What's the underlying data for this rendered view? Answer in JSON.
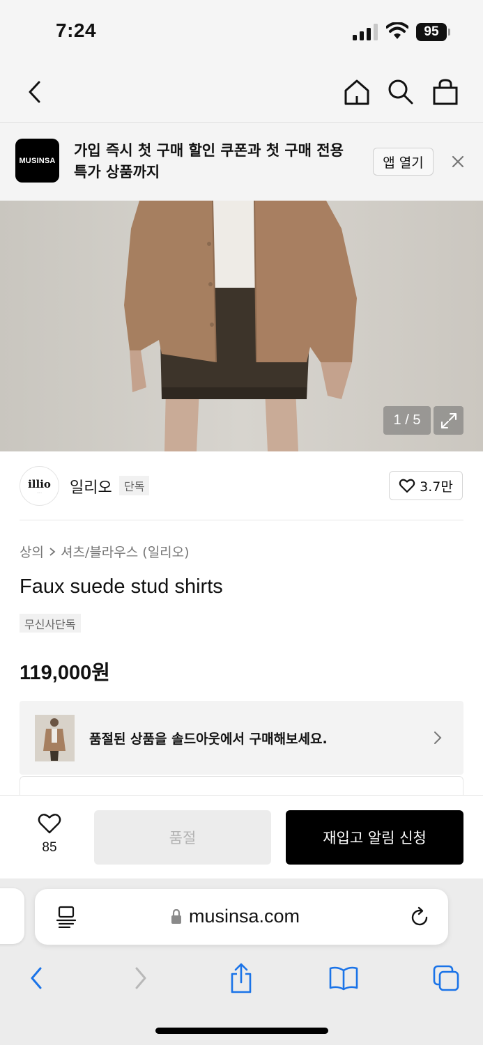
{
  "status_bar": {
    "time": "7:24",
    "battery": "95"
  },
  "nav": {
    "icons": [
      "back-chevron-icon",
      "home-icon",
      "search-icon",
      "shopping-bag-icon"
    ]
  },
  "promo": {
    "logo_text": "MUSINSA",
    "message": "가입 즉시 첫 구매 할인 쿠폰과 첫 구매 전용 특가 상품까지",
    "open_app_label": "앱 열기"
  },
  "gallery": {
    "counter": "1 / 5",
    "current": 1,
    "total": 5
  },
  "brand": {
    "logo_text": "illio",
    "name": "일리오",
    "badge": "단독",
    "likes": "3.7만"
  },
  "product": {
    "breadcrumb_category": "상의",
    "breadcrumb_sub": "셔츠/블라우스 (일리오)",
    "title": "Faux suede stud shirts",
    "tag": "무신사단독",
    "price": "119,000원"
  },
  "soldout_banner": {
    "text": "품절된 상품을 솔드아웃에서 구매해보세요."
  },
  "actions": {
    "wish_count": "85",
    "soldout_label": "품절",
    "restock_label": "재입고 알림 신청"
  },
  "browser": {
    "url": "musinsa.com"
  },
  "colors": {
    "accent": "#000000",
    "soldout_bg": "#ececec",
    "safari_blue": "#1a73e8"
  }
}
